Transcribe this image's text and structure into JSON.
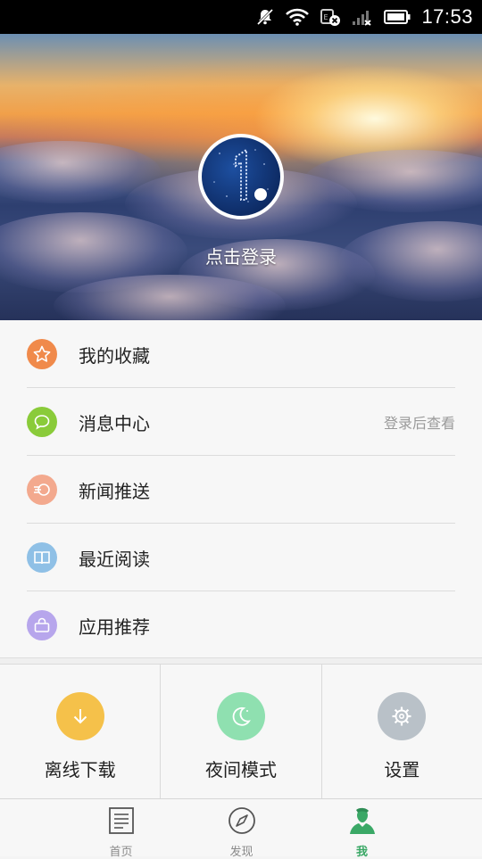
{
  "status_bar": {
    "time": "17:53"
  },
  "header": {
    "login_text": "点击登录"
  },
  "menu": {
    "items": [
      {
        "label": "我的收藏",
        "icon": "star-icon",
        "color": "#f08a4b"
      },
      {
        "label": "消息中心",
        "icon": "chat-bubble-icon",
        "color": "#8acb3a",
        "hint": "登录后查看"
      },
      {
        "label": "新闻推送",
        "icon": "push-icon",
        "color": "#f3a98e"
      },
      {
        "label": "最近阅读",
        "icon": "book-icon",
        "color": "#8fc0e6"
      },
      {
        "label": "应用推荐",
        "icon": "bag-icon",
        "color": "#b7a6ec"
      }
    ]
  },
  "grid": {
    "items": [
      {
        "label": "离线下载",
        "icon": "download-icon",
        "color": "#f5c14a"
      },
      {
        "label": "夜间模式",
        "icon": "moon-icon",
        "color": "#8fe0b0"
      },
      {
        "label": "设置",
        "icon": "gear-icon",
        "color": "#b9c1c8"
      }
    ]
  },
  "tabbar": {
    "items": [
      {
        "label": "首页",
        "icon": "news-icon"
      },
      {
        "label": "发现",
        "icon": "compass-icon"
      },
      {
        "label": "我",
        "icon": "person-icon",
        "active": true
      }
    ],
    "active_color": "#3aa866"
  }
}
